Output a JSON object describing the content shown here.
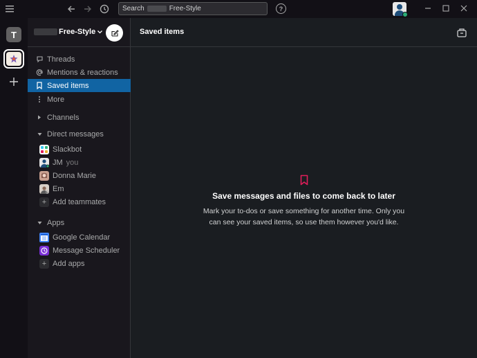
{
  "titlebar": {
    "search_prefix": "Search",
    "search_suffix": "Free-Style",
    "help": "?"
  },
  "workspace_rail": {
    "initial": "T"
  },
  "sidebar": {
    "workspace_name": "Free-Style",
    "nav": [
      {
        "label": "Threads",
        "icon": "threads-icon"
      },
      {
        "label": "Mentions & reactions",
        "icon": "at-icon"
      },
      {
        "label": "Saved items",
        "icon": "bookmark-icon",
        "active": true
      },
      {
        "label": "More",
        "icon": "more-icon"
      }
    ],
    "channels_label": "Channels",
    "dms_label": "Direct messages",
    "dms": [
      {
        "name": "Slackbot",
        "you": ""
      },
      {
        "name": "JM",
        "you": "you"
      },
      {
        "name": "Donna Marie",
        "you": ""
      },
      {
        "name": "Em",
        "you": ""
      }
    ],
    "add_teammates": "Add teammates",
    "apps_label": "Apps",
    "apps": [
      {
        "name": "Google Calendar"
      },
      {
        "name": "Message Scheduler"
      }
    ],
    "add_apps": "Add apps"
  },
  "main": {
    "title": "Saved items",
    "empty_title": "Save messages and files to come back to later",
    "empty_body": "Mark your to-dos or save something for another time. Only you can see your saved items, so use them however you'd like."
  },
  "colors": {
    "accent_active": "#1164a3",
    "bookmark_pink": "#e01e5a",
    "presence_green": "#2bac76"
  }
}
